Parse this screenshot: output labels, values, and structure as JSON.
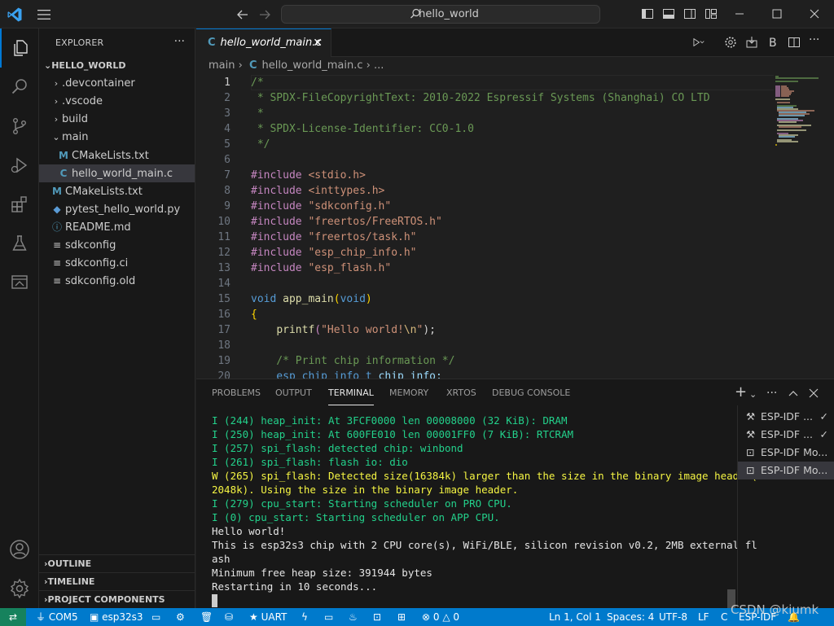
{
  "titlebar": {
    "search_text": "hello_world"
  },
  "sidebar": {
    "header": "EXPLORER",
    "root": "HELLO_WORLD",
    "items": [
      {
        "label": ".devcontainer",
        "icon": "chevron-right-icon"
      },
      {
        "label": ".vscode",
        "icon": "chevron-right-icon"
      },
      {
        "label": "build",
        "icon": "chevron-right-icon"
      },
      {
        "label": "main",
        "icon": "chevron-down-icon"
      },
      {
        "label": "CMakeLists.txt",
        "icon": "cmake-file-icon"
      },
      {
        "label": "hello_world_main.c",
        "icon": "c-file-icon"
      },
      {
        "label": "CMakeLists.txt",
        "icon": "cmake-file-icon"
      },
      {
        "label": "pytest_hello_world.py",
        "icon": "python-file-icon"
      },
      {
        "label": "README.md",
        "icon": "info-file-icon"
      },
      {
        "label": "sdkconfig",
        "icon": "config-file-icon"
      },
      {
        "label": "sdkconfig.ci",
        "icon": "config-file-icon"
      },
      {
        "label": "sdkconfig.old",
        "icon": "config-file-icon"
      }
    ],
    "sections": [
      "OUTLINE",
      "TIMELINE",
      "PROJECT COMPONENTS"
    ]
  },
  "editor": {
    "tab_label": "hello_world_main.c",
    "breadcrumb": {
      "folder": "main",
      "file": "hello_world_main.c",
      "more": "..."
    },
    "line_numbers": [
      "1",
      "2",
      "3",
      "4",
      "5",
      "6",
      "7",
      "8",
      "9",
      "10",
      "11",
      "12",
      "13",
      "14",
      "15",
      "16",
      "17",
      "18",
      "19",
      "20"
    ],
    "code": {
      "l1": "/*",
      "l2": " * SPDX-FileCopyrightText: 2010-2022 Espressif Systems (Shanghai) CO LTD",
      "l3": " *",
      "l4": " * SPDX-License-Identifier: CC0-1.0",
      "l5": " */",
      "include": "#include",
      "l7": "<stdio.h>",
      "l8": "<inttypes.h>",
      "l9": "\"sdkconfig.h\"",
      "l10": "\"freertos/FreeRTOS.h\"",
      "l11": "\"freertos/task.h\"",
      "l12": "\"esp_chip_info.h\"",
      "l13": "\"esp_flash.h\"",
      "void": "void",
      "app_main": "app_main",
      "open_paren": "(",
      "close_paren": ")",
      "open_brace": "{",
      "indent": "    ",
      "printf": "printf",
      "hello_str": "\"Hello world!",
      "newline_esc": "\\n",
      "quote": "\"",
      "stmt_end": ");",
      "l19": "    /* Print chip information */",
      "l20_type": "    esp_chip_info_t",
      "l20_var": " chip_info;"
    }
  },
  "panel": {
    "tabs": [
      "PROBLEMS",
      "OUTPUT",
      "TERMINAL",
      "MEMORY",
      "XRTOS",
      "DEBUG CONSOLE"
    ],
    "active_tab": "TERMINAL",
    "terminal_lines": [
      {
        "text": "I (244) heap_init: At 3FCF0000 len 00008000 (32 KiB): DRAM",
        "color": "green"
      },
      {
        "text": "I (250) heap_init: At 600FE010 len 00001FF0 (7 KiB): RTCRAM",
        "color": "green"
      },
      {
        "text": "I (257) spi_flash: detected chip: winbond",
        "color": "green"
      },
      {
        "text": "I (261) spi_flash: flash io: dio",
        "color": "green"
      },
      {
        "text": "W (265) spi_flash: Detected size(16384k) larger than the size in the binary image header(",
        "color": "yellow"
      },
      {
        "text": "2048k). Using the size in the binary image header.",
        "color": "yellow"
      },
      {
        "text": "I (279) cpu_start: Starting scheduler on PRO CPU.",
        "color": "green"
      },
      {
        "text": "I (0) cpu_start: Starting scheduler on APP CPU.",
        "color": "green"
      },
      {
        "text": "Hello world!",
        "color": "white"
      },
      {
        "text": "This is esp32s3 chip with 2 CPU core(s), WiFi/BLE, silicon revision v0.2, 2MB external fl",
        "color": "white"
      },
      {
        "text": "ash",
        "color": "white"
      },
      {
        "text": "Minimum free heap size: 391944 bytes",
        "color": "white"
      },
      {
        "text": "Restarting in 10 seconds...",
        "color": "white"
      }
    ],
    "terminals": [
      {
        "label": "ESP-IDF ...",
        "icon": "tools-icon",
        "check": "✓"
      },
      {
        "label": "ESP-IDF ...",
        "icon": "tools-icon",
        "check": "✓"
      },
      {
        "label": "ESP-IDF Mo...",
        "icon": "terminal-icon"
      },
      {
        "label": "ESP-IDF Mo...",
        "icon": "terminal-icon"
      }
    ]
  },
  "statusbar": {
    "port": "COM5",
    "target": "esp32s3",
    "flash_method": "UART",
    "errors": "0",
    "warnings": "0",
    "position": "Ln 1, Col 1",
    "spaces": "Spaces: 4",
    "encoding": "UTF-8",
    "eol": "LF",
    "language": "C",
    "extension": "ESP-IDF"
  },
  "watermark": "CSDN @kiumk",
  "colors": {
    "accent": "#0078d4",
    "statusbar": "#007acc",
    "remote": "#16825d"
  }
}
